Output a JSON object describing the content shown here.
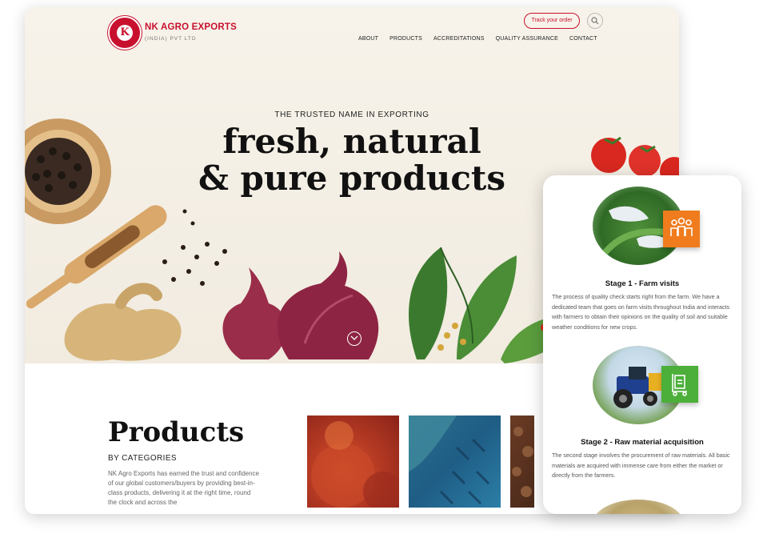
{
  "brand": {
    "name": "NK AGRO EXPORTS",
    "sub": "(INDIA) PVT LTD",
    "logo_letter": "K",
    "color": "#c8102e"
  },
  "header": {
    "track_label": "Track your order",
    "search_icon": "search-icon"
  },
  "nav": {
    "items": [
      "ABOUT",
      "PRODUCTS",
      "ACCREDITATIONS",
      "QUALITY ASSURANCE",
      "CONTACT"
    ]
  },
  "hero": {
    "eyebrow": "THE TRUSTED NAME IN EXPORTING",
    "headline_line1": "fresh, natural",
    "headline_line2": "& pure products"
  },
  "products": {
    "title": "Products",
    "subtitle": "BY CATEGORIES",
    "description": "NK Agro Exports has earned the trust and confidence of our global customers/buyers by providing best-in-class products, delivering it at the right time, round the clock and across the"
  },
  "mobile": {
    "stages": [
      {
        "title": "Stage 1 - Farm visits",
        "text": "The process of quality check starts right from the farm. We have a dedicated team that goes on farm visits throughout India and interacts with farmers to obtain their opinions on the quality of soil and suitable weather conditions for new crops.",
        "badge_color": "#f07c1e",
        "icon": "people-icon"
      },
      {
        "title": "Stage 2 - Raw material acquisition",
        "text": "The second stage involves the procurement of raw materials. All basic materials are acquired with immense care from either the market or directly from the farmers.",
        "badge_color": "#4caf3a",
        "icon": "trolley-icon"
      }
    ]
  }
}
